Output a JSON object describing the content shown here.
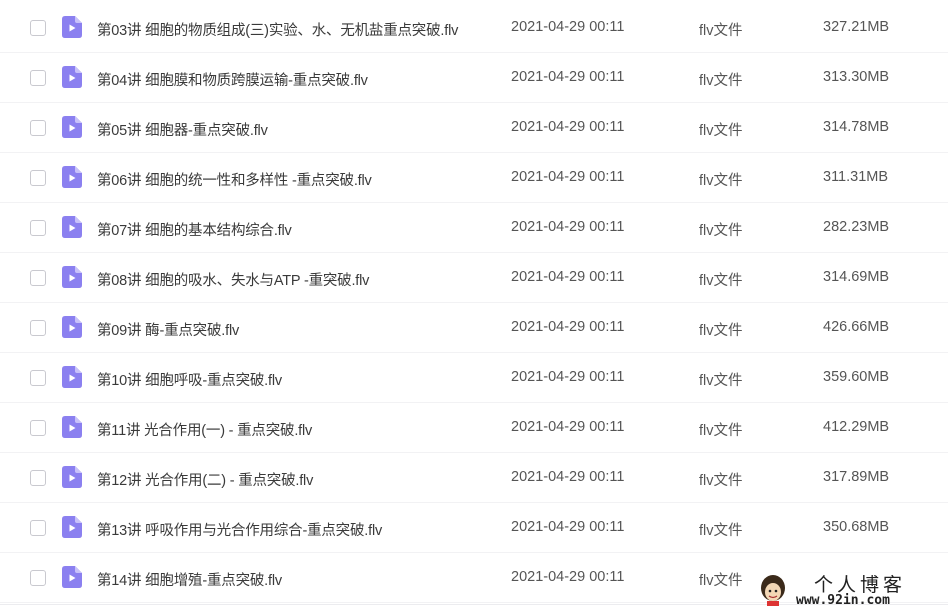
{
  "files": [
    {
      "name": "第03讲 细胞的物质组成(三)实验、水、无机盐重点突破.flv",
      "date": "2021-04-29 00:11",
      "type": "flv文件",
      "size": "327.21MB"
    },
    {
      "name": "第04讲 细胞膜和物质跨膜运输-重点突破.flv",
      "date": "2021-04-29 00:11",
      "type": "flv文件",
      "size": "313.30MB"
    },
    {
      "name": "第05讲 细胞器-重点突破.flv",
      "date": "2021-04-29 00:11",
      "type": "flv文件",
      "size": "314.78MB"
    },
    {
      "name": "第06讲 细胞的统一性和多样性 -重点突破.flv",
      "date": "2021-04-29 00:11",
      "type": "flv文件",
      "size": "311.31MB"
    },
    {
      "name": "第07讲 细胞的基本结构综合.flv",
      "date": "2021-04-29 00:11",
      "type": "flv文件",
      "size": "282.23MB"
    },
    {
      "name": "第08讲 细胞的吸水、失水与ATP -重突破.flv",
      "date": "2021-04-29 00:11",
      "type": "flv文件",
      "size": "314.69MB"
    },
    {
      "name": "第09讲 酶-重点突破.flv",
      "date": "2021-04-29 00:11",
      "type": "flv文件",
      "size": "426.66MB"
    },
    {
      "name": "第10讲 细胞呼吸-重点突破.flv",
      "date": "2021-04-29 00:11",
      "type": "flv文件",
      "size": "359.60MB"
    },
    {
      "name": "第11讲 光合作用(一) - 重点突破.flv",
      "date": "2021-04-29 00:11",
      "type": "flv文件",
      "size": "412.29MB"
    },
    {
      "name": "第12讲 光合作用(二) - 重点突破.flv",
      "date": "2021-04-29 00:11",
      "type": "flv文件",
      "size": "317.89MB"
    },
    {
      "name": "第13讲 呼吸作用与光合作用综合-重点突破.flv",
      "date": "2021-04-29 00:11",
      "type": "flv文件",
      "size": "350.68MB"
    },
    {
      "name": "第14讲 细胞增殖-重点突破.flv",
      "date": "2021-04-29 00:11",
      "type": "flv文件",
      "size": ""
    }
  ],
  "watermark": {
    "title": "个人博客",
    "url": "www.92in.com"
  },
  "colors": {
    "file_icon": "#8b80f0",
    "file_icon_fold": "#c8c2fa",
    "checkbox_border": "#c9c9cf",
    "row_divider": "#f2f2f4"
  },
  "icons": {
    "file": "video-file-icon",
    "checkbox": "checkbox-icon"
  }
}
